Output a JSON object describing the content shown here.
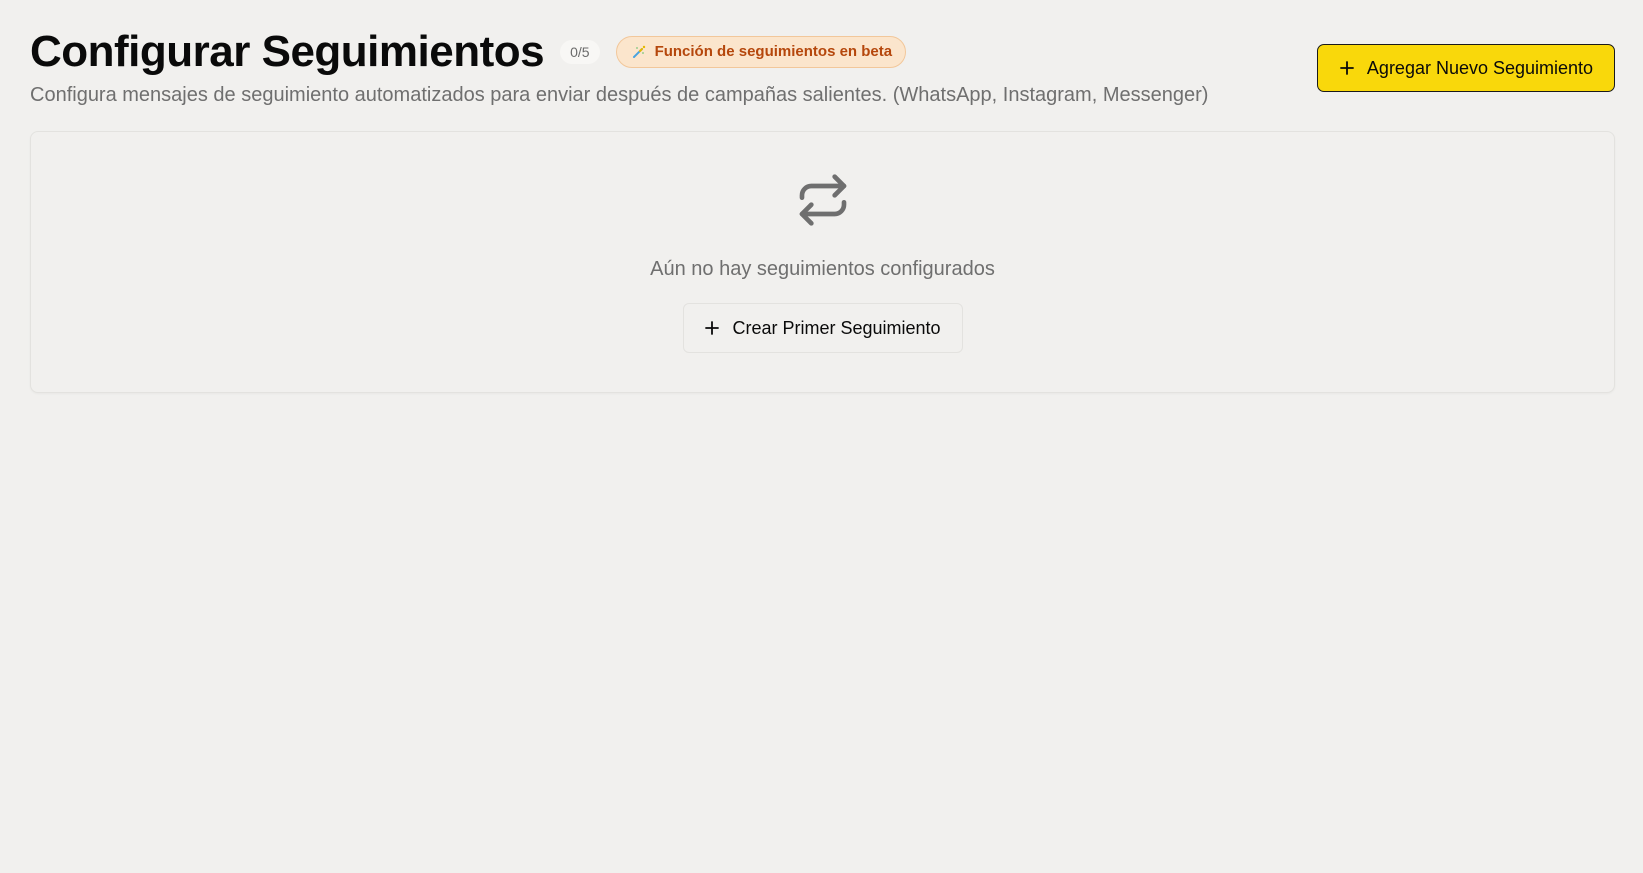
{
  "header": {
    "title": "Configurar Seguimientos",
    "count_badge": "0/5",
    "beta_badge": {
      "icon": "sparkle-wand-icon",
      "label": "Función de seguimientos en beta"
    },
    "subtitle": "Configura mensajes de seguimiento automatizados para enviar después de campañas salientes. (WhatsApp, Instagram, Messenger)"
  },
  "toolbar": {
    "add_button": {
      "icon": "plus-icon",
      "label": "Agregar Nuevo Seguimiento"
    }
  },
  "empty_state": {
    "icon": "repeat-icon",
    "message": "Aún no hay seguimientos configurados",
    "create_button": {
      "icon": "plus-icon",
      "label": "Crear Primer Seguimiento"
    }
  },
  "colors": {
    "background": "#f1f0ee",
    "accent_button": "#f9d80b",
    "beta_badge_bg": "#fbe5cc",
    "beta_badge_text": "#b5470c"
  }
}
